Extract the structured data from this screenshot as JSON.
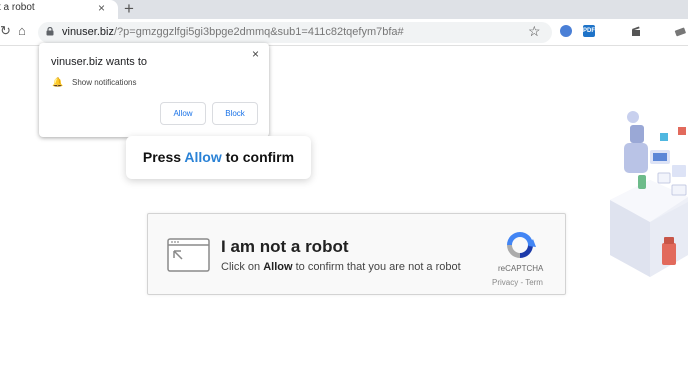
{
  "browser": {
    "tab_title": "t a robot",
    "tab_close": "×",
    "new_tab": "+",
    "back": "‹",
    "reload": "↻",
    "home": "⌂",
    "url_host": "vinuser.biz",
    "url_path": "/?p=gmzggzlfgi5gi3bpge2dmmq&sub1=411c82tqefym7bfa#",
    "star": "☆",
    "extensions": [
      {
        "icon": "blue-circle-extension-icon",
        "color": "#4a7fd6",
        "label": ""
      },
      {
        "icon": "pdf-extension-icon",
        "color": "#1e73c8",
        "label": "PDF"
      },
      {
        "icon": "clapper-extension-icon",
        "color": "#555555",
        "label": ""
      },
      {
        "icon": "account-extension-icon",
        "color": "#888888",
        "label": ""
      }
    ]
  },
  "notification": {
    "title": "vinuser.biz wants to",
    "close": "×",
    "bell": "🔔",
    "text": "Show notifications",
    "allow": "Allow",
    "block": "Block"
  },
  "press": {
    "prefix": "Press ",
    "allow": "Allow",
    "suffix": " to confirm"
  },
  "captcha": {
    "title": "I am not a robot",
    "sub_prefix": "Click on ",
    "sub_bold": "Allow",
    "sub_suffix": " to confirm that you are not a robot",
    "brand": "reCAPTCHA",
    "links": "Privacy - Term"
  },
  "colors": {
    "accent": "#2a82d6",
    "button_text": "#1a73e8"
  }
}
